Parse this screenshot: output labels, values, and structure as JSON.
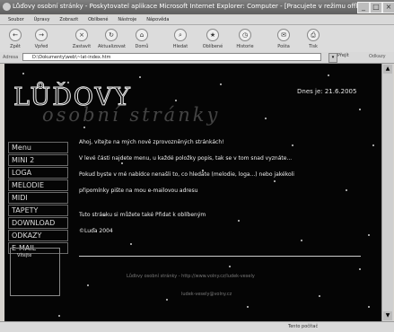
{
  "window": {
    "title": "Lůďovy osobní stránky - Poskytovatel aplikace Microsoft Internet Explorer: Computer - [Pracujete v režimu offline]"
  },
  "menubar": [
    "Soubor",
    "Úpravy",
    "Zobrazit",
    "Oblíbené",
    "Nástroje",
    "Nápověda"
  ],
  "toolbar": [
    {
      "label": "Zpět",
      "icon": "back-icon"
    },
    {
      "label": "Vpřed",
      "icon": "forward-icon"
    },
    {
      "label": "Zastavit",
      "icon": "stop-icon"
    },
    {
      "label": "Aktualizovat",
      "icon": "refresh-icon"
    },
    {
      "label": "Domů",
      "icon": "home-icon"
    },
    {
      "label": "Hledat",
      "icon": "search-icon"
    },
    {
      "label": "Oblíbené",
      "icon": "favorites-icon"
    },
    {
      "label": "Historie",
      "icon": "history-icon"
    },
    {
      "label": "Pošta",
      "icon": "mail-icon"
    },
    {
      "label": "Tisk",
      "icon": "print-icon"
    }
  ],
  "address": {
    "label": "Adresa",
    "value": "D:\\Dokumenty\\web\\~lat-index.htm",
    "go": "Přejít",
    "links": "Odkazy"
  },
  "page": {
    "logo_line1": "LŮĎOVY",
    "logo_line2": "osobní stránky",
    "date": "Dnes je: 21.6.2005",
    "menu": [
      "Menu",
      "MINI 2",
      "LOGA",
      "MELODIE",
      "MIDI",
      "TAPETY",
      "DOWNLOAD",
      "ODKAZY",
      "E-MAIL"
    ],
    "welcome_box": "Vítejte",
    "paragraphs": [
      "Ahoj, vítejte na mých nově zprovozněných stránkách!",
      "V levé části najdete menu, u každé položky popis, tak se v tom snad vyznáte...",
      "Pokud byste v mé nabídce nenašli to, co hledáte (melodie, loga...) nebo jakékoli",
      "připomínky pište na mou e-mailovou adresu",
      "Tuto stránku si můžete také Přidat k oblíbeným",
      "©Luďa 2004"
    ],
    "footer_url": "Lůďovy osobní stránky - http://www.volny.cz/ludek-vesely",
    "footer_email": "ludek-vesely@volny.cz"
  },
  "status": {
    "zone": "Tento počítač"
  }
}
